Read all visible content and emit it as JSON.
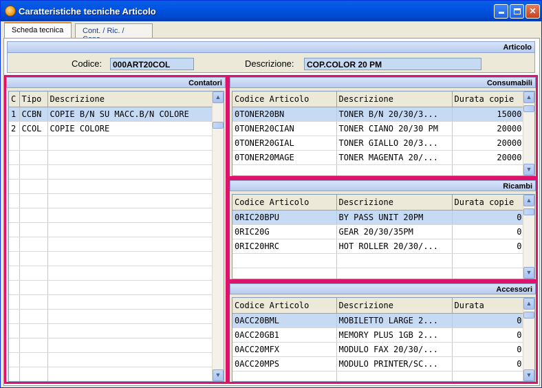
{
  "window": {
    "title": "Caratteristiche tecniche Articolo"
  },
  "tabs": [
    {
      "label": "Scheda tecnica"
    },
    {
      "label": "Cont. / Ric. / Cons."
    }
  ],
  "articolo": {
    "header": "Articolo",
    "codice_label": "Codice:",
    "codice_value": "000ART20COL",
    "descrizione_label": "Descrizione:",
    "descrizione_value": "COP.COLOR 20 PM"
  },
  "contatori": {
    "header": "Contatori",
    "columns": [
      "C",
      "Tipo",
      "Descrizione"
    ],
    "rows": [
      [
        "1",
        "CCBN",
        "COPIE B/N SU MACC.B/N COLORE"
      ],
      [
        "2",
        "CCOL",
        "COPIE COLORE"
      ]
    ]
  },
  "consumabili": {
    "header": "Consumabili",
    "columns": [
      "Codice Articolo",
      "Descrizione",
      "Durata copie"
    ],
    "rows": [
      [
        "0TONER20BN",
        "TONER B/N 20/30/3...",
        "15000"
      ],
      [
        "0TONER20CIAN",
        "TONER CIANO 20/30 PM",
        "20000"
      ],
      [
        "0TONER20GIAL",
        "TONER GIALLO 20/3...",
        "20000"
      ],
      [
        "0TONER20MAGE",
        "TONER MAGENTA 20/...",
        "20000"
      ]
    ]
  },
  "ricambi": {
    "header": "Ricambi",
    "columns": [
      "Codice Articolo",
      "Descrizione",
      "Durata copie"
    ],
    "rows": [
      [
        "0RIC20BPU",
        "BY PASS UNIT 20PM",
        "0"
      ],
      [
        "0RIC20G",
        "GEAR 20/30/35PM",
        "0"
      ],
      [
        "0RIC20HRC",
        "HOT ROLLER 20/30/...",
        "0"
      ]
    ]
  },
  "accessori": {
    "header": "Accessori",
    "columns": [
      "Codice Articolo",
      "Descrizione",
      "Durata"
    ],
    "rows": [
      [
        "0ACC20BML",
        "MOBILETTO LARGE 2...",
        "0"
      ],
      [
        "0ACC20GB1",
        "MEMORY PLUS 1GB 2...",
        "0"
      ],
      [
        "0ACC20MFX",
        "MODULO FAX 20/30/...",
        "0"
      ],
      [
        "0ACC20MPS",
        "MODULO PRINTER/SC...",
        "0"
      ]
    ]
  },
  "icons": {
    "app": "app-icon",
    "minimize": "minimize-icon",
    "maximize": "maximize-icon",
    "close": "close-icon",
    "scroll_up": "▲",
    "scroll_down": "▼",
    "close_glyph": "✕"
  }
}
